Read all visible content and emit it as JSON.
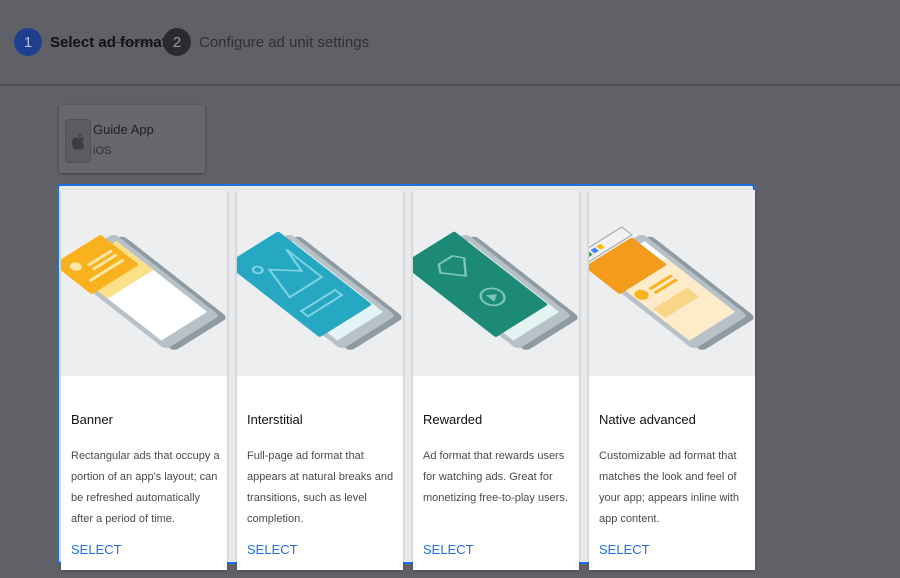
{
  "stepper": {
    "step1": {
      "number": "1",
      "label": "Select ad format"
    },
    "step2": {
      "number": "2",
      "label": "Configure ad unit settings"
    }
  },
  "app": {
    "name": "Guide App",
    "platform": "iOS",
    "icon": "apple-icon"
  },
  "formats": [
    {
      "title": "Banner",
      "description": "Rectangular ads that occupy a portion of an app's layout; can be refreshed automatically after a period of time.",
      "select_label": "SELECT"
    },
    {
      "title": "Interstitial",
      "description": "Full-page ad format that appears at natural breaks and transitions, such as level completion.",
      "select_label": "SELECT"
    },
    {
      "title": "Rewarded",
      "description": "Ad format that rewards users for watching ads. Great for monetizing free-to-play users.",
      "select_label": "SELECT"
    },
    {
      "title": "Native advanced",
      "description": "Customizable ad format that matches the look and feel of your app; appears inline with app content.",
      "select_label": "SELECT"
    }
  ],
  "colors": {
    "accent": "#1a73e8",
    "banner": "#f9b21d",
    "interstitial": "#26a8c3",
    "rewarded": "#1c8a76",
    "native": "#f39c1c"
  }
}
